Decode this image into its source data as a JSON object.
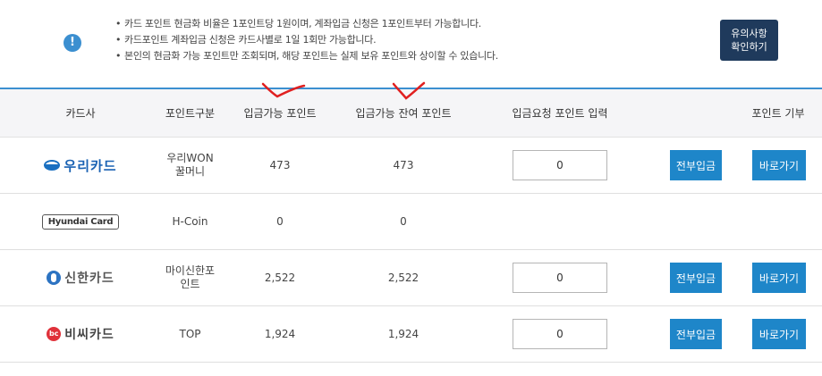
{
  "notice": {
    "icon": "exclamation-icon",
    "lines": [
      "카드 포인트 현금화 비율은 1포인트당 1원이며, 계좌입금 신청은 1포인트부터 가능합니다.",
      "카드포인트 계좌입금 신청은 카드사별로 1일 1회만 가능합니다.",
      "본인의 현금화 가능 포인트만 조회되며, 해당 포인트는 실제 보유 포인트와 상이할 수 있습니다."
    ],
    "button_line1": "유의사항",
    "button_line2": "확인하기"
  },
  "table": {
    "headers": {
      "card": "카드사",
      "type": "포인트구분",
      "available": "입금가능 포인트",
      "balance": "입금가능 잔여 포인트",
      "request": "입금요청 포인트 입력",
      "donate": "포인트 기부"
    },
    "rows": [
      {
        "card": "우리카드",
        "type_line1": "우리WON",
        "type_line2": "꿀머니",
        "available": "473",
        "balance": "473",
        "input": "0",
        "all_label": "전부입금",
        "go_label": "바로가기"
      },
      {
        "card": "Hyundai Card",
        "type_line1": "H-Coin",
        "type_line2": "",
        "available": "0",
        "balance": "0"
      },
      {
        "card": "신한카드",
        "type_line1": "마이신한포",
        "type_line2": "인트",
        "available": "2,522",
        "balance": "2,522",
        "input": "0",
        "all_label": "전부입금",
        "go_label": "바로가기"
      },
      {
        "card": "비씨카드",
        "type_line1": "TOP",
        "type_line2": "",
        "available": "1,924",
        "balance": "1,924",
        "input": "0",
        "all_label": "전부입금",
        "go_label": "바로가기"
      }
    ]
  },
  "colors": {
    "accent": "#1e86c9",
    "dark_button": "#1f3a5c",
    "annotation": "#e02020"
  }
}
